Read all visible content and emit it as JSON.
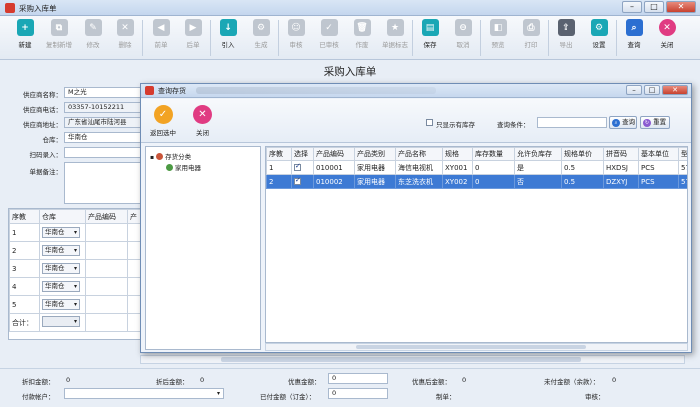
{
  "window": {
    "title": "采购入库单",
    "min": "–",
    "max": "□",
    "close": "✕"
  },
  "toolbar": [
    {
      "label": "新建",
      "glyph": "+",
      "enabled": true
    },
    {
      "label": "复制新增",
      "glyph": "⧉",
      "enabled": false
    },
    {
      "label": "修改",
      "glyph": "✎",
      "enabled": false
    },
    {
      "label": "删除",
      "glyph": "✕",
      "enabled": false
    },
    {
      "label": "前单",
      "glyph": "◀",
      "enabled": false
    },
    {
      "label": "后单",
      "glyph": "▶",
      "enabled": false
    },
    {
      "label": "引入",
      "glyph": "↓",
      "enabled": true
    },
    {
      "label": "生成",
      "glyph": "⚙",
      "enabled": false
    },
    {
      "label": "审核",
      "glyph": "☺",
      "enabled": false
    },
    {
      "label": "已审核",
      "glyph": "✓",
      "enabled": false
    },
    {
      "label": "作废",
      "glyph": "🗑",
      "enabled": false
    },
    {
      "label": "单据标志",
      "glyph": "★",
      "enabled": false
    },
    {
      "label": "保存",
      "glyph": "▤",
      "enabled": true
    },
    {
      "label": "取消",
      "glyph": "⊖",
      "enabled": false
    },
    {
      "label": "预览",
      "glyph": "◧",
      "enabled": false
    },
    {
      "label": "打印",
      "glyph": "⎙",
      "enabled": false
    },
    {
      "label": "导出",
      "glyph": "⇪",
      "enabled": false
    },
    {
      "label": "设置",
      "glyph": "⚙",
      "enabled": true
    },
    {
      "label": "查询",
      "glyph": "⌕",
      "enabled": true
    },
    {
      "label": "关闭",
      "glyph": "✕",
      "enabled": true
    }
  ],
  "form": {
    "title": "采购入库单",
    "supplier_label": "供应商名称：",
    "supplier": "M之光",
    "phone_label": "供应商电话：",
    "phone": "03357-10152211",
    "address_label": "供应商地址：",
    "address": "广东省汕尾市陆河县",
    "warehouse_label": "仓库：",
    "warehouse": "华南仓",
    "scanner_label": "扫码录入：",
    "remarks_label": "单据备注："
  },
  "grid": {
    "headers": [
      "序教",
      "仓库",
      "产品编码",
      "产"
    ],
    "rows": [
      {
        "n": "1",
        "wh": "华南仓"
      },
      {
        "n": "2",
        "wh": "华南仓"
      },
      {
        "n": "3",
        "wh": "华南仓"
      },
      {
        "n": "4",
        "wh": "华南仓"
      },
      {
        "n": "5",
        "wh": "华南仓"
      }
    ],
    "total_label": "合计："
  },
  "footer": {
    "pre_discount_label": "折扣金额：",
    "pre_discount": "0",
    "post_discount_label": "折后金额：",
    "post_discount": "0",
    "promo_label": "优惠金额：",
    "promo": "0",
    "after_promo_label": "优惠后金额：",
    "after_promo": "0",
    "unpaid_label": "未付金额（余款）：",
    "unpaid": "0",
    "account_label": "付款帐户：",
    "paid_label": "已付金额（订金）：",
    "paid": "0",
    "maker_label": "制单：",
    "auditor_label": "审核："
  },
  "dialog": {
    "title": "查询存货",
    "back_label": "返回选中",
    "close_label": "关闭",
    "show_stock_label": "只显示有库存",
    "query_label": "查询条件：",
    "query_value": "",
    "search_btn": "查询",
    "reset_btn": "重置",
    "tree_root": "存货分类",
    "tree_child": "家用电器",
    "columns": [
      "序教",
      "选择",
      "产品编码",
      "产品类别",
      "产品名称",
      "规格",
      "库存数量",
      "允许负库存",
      "规格单价",
      "拼音码",
      "基本单位",
      "型"
    ],
    "rows": [
      {
        "n": "1",
        "code": "010001",
        "cat": "家用电器",
        "name": "海信电视机",
        "spec": "XY001",
        "qty": "0",
        "neg": "是",
        "price": "0.5",
        "py": "HXDSJ",
        "unit": "PCS",
        "model": "57",
        "selected": false
      },
      {
        "n": "2",
        "code": "010002",
        "cat": "家用电器",
        "name": "东芝洗衣机",
        "spec": "XY002",
        "qty": "0",
        "neg": "否",
        "price": "0.5",
        "py": "DZXYJ",
        "unit": "PCS",
        "model": "57",
        "selected": true
      }
    ]
  },
  "colors": {
    "accent": "#3d7ad4",
    "close": "#e03b82",
    "ok": "#f2a324",
    "title_bg": "#c4d6ee"
  }
}
